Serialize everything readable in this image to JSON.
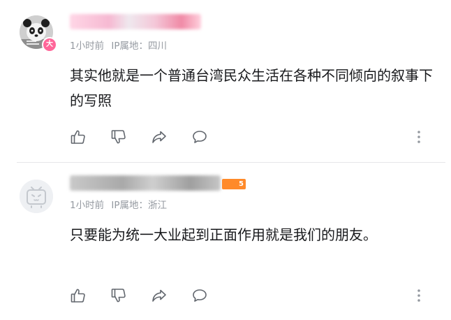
{
  "comments": [
    {
      "avatar_badge": "大",
      "time": "1小时前",
      "ip_label": "IP属地：",
      "ip_location": "四川",
      "content": "其实他就是一个普通台湾民众生活在各种不同倾向的叙事下的写照"
    },
    {
      "level_badge": "5",
      "time": "1小时前",
      "ip_label": "IP属地：",
      "ip_location": "浙江",
      "content": "只要能为统一大业起到正面作用就是我们的朋友。"
    }
  ],
  "icons": {
    "like": "thumbs-up-icon",
    "dislike": "thumbs-down-icon",
    "share": "share-icon",
    "reply": "comment-icon",
    "more": "more-vertical-icon"
  },
  "colors": {
    "text": "#18191c",
    "meta": "#9499a0",
    "icon": "#61666d",
    "badge_pink": "#ff6699",
    "level_orange": "#ff8a2a",
    "divider": "#e6e7e9"
  }
}
